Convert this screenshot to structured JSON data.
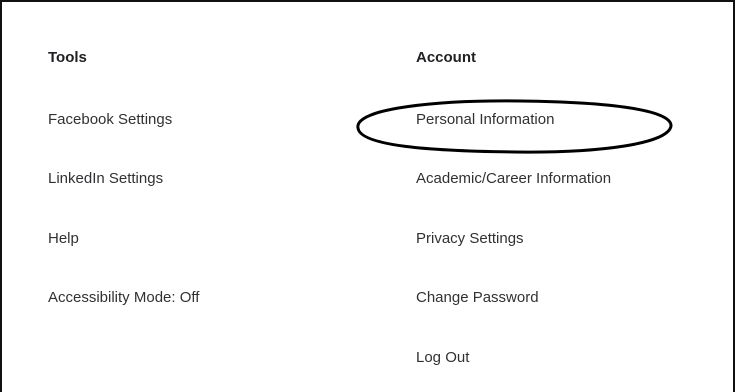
{
  "tools": {
    "heading": "Tools",
    "items": [
      "Facebook Settings",
      "LinkedIn Settings",
      "Help",
      "Accessibility Mode: Off"
    ]
  },
  "account": {
    "heading": "Account",
    "items": [
      "Personal Information",
      "Academic/Career Information",
      "Privacy Settings",
      "Change Password",
      "Log Out"
    ]
  },
  "annotation": {
    "shape": "ellipse",
    "stroke_color": "#000000",
    "highlights": "Personal Information"
  }
}
